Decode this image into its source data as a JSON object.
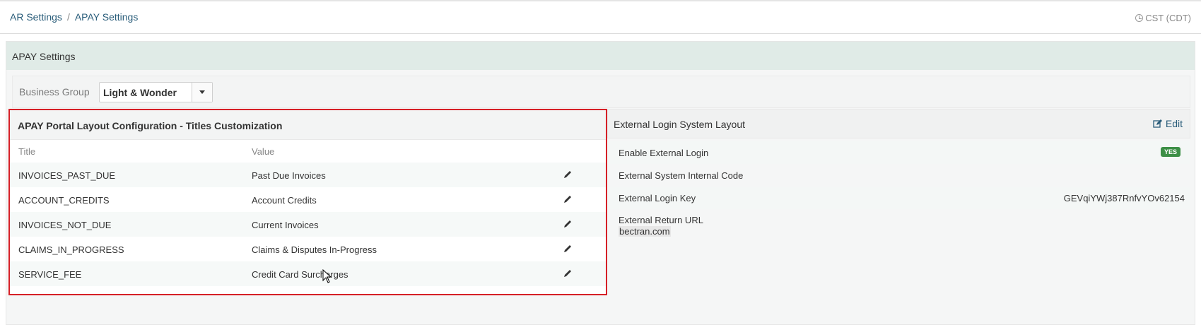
{
  "breadcrumb": {
    "item1": "AR Settings",
    "separator": "/",
    "item2": "APAY Settings"
  },
  "timezone": "CST (CDT)",
  "panel": {
    "title": "APAY Settings"
  },
  "business_group": {
    "label": "Business Group",
    "selected": "Light & Wonder"
  },
  "left_card": {
    "title": "APAY Portal Layout Configuration - Titles Customization",
    "col_title": "Title",
    "col_value": "Value",
    "rows": [
      {
        "title": "INVOICES_PAST_DUE",
        "value": "Past Due Invoices"
      },
      {
        "title": "ACCOUNT_CREDITS",
        "value": "Account Credits"
      },
      {
        "title": "INVOICES_NOT_DUE",
        "value": "Current Invoices"
      },
      {
        "title": "CLAIMS_IN_PROGRESS",
        "value": "Claims & Disputes In-Progress"
      },
      {
        "title": "SERVICE_FEE",
        "value": "Credit Card Surcharges"
      }
    ]
  },
  "right_card": {
    "title": "External Login System Layout",
    "edit_label": "Edit",
    "enable_label": "Enable External Login",
    "enable_badge": "YES",
    "internal_code_label": "External System Internal Code",
    "login_key_label": "External Login Key",
    "login_key_value": "GEVqiYWj387RnfvYOv62154",
    "return_url_label": "External Return URL",
    "return_url_value": "bectran.com"
  },
  "colors": {
    "highlight_border": "#d62027",
    "badge_green": "#3d8f46",
    "link": "#2a5d7a"
  }
}
